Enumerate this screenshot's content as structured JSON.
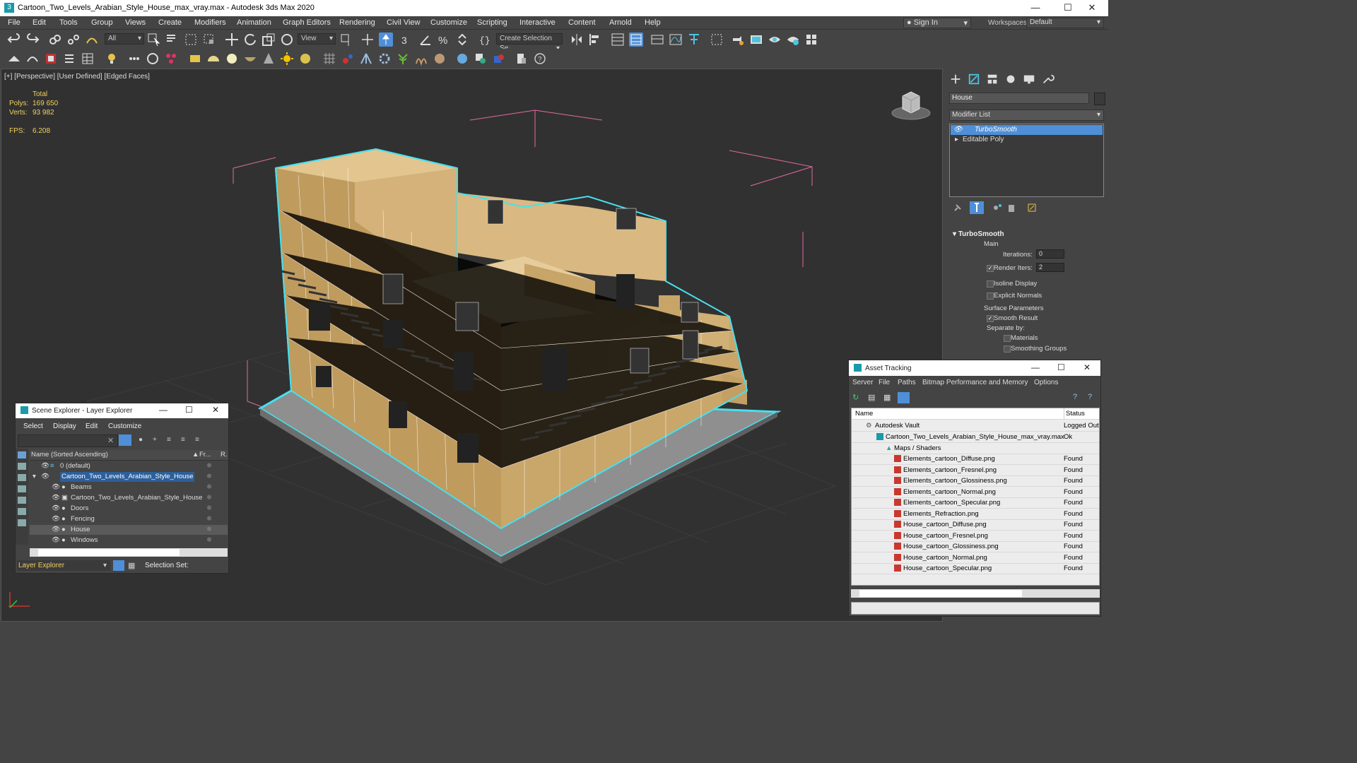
{
  "window": {
    "title": "Cartoon_Two_Levels_Arabian_Style_House_max_vray.max - Autodesk 3ds Max 2020",
    "app_icon": "3",
    "controls": {
      "minimize": "—",
      "maximize": "☐",
      "close": "✕"
    }
  },
  "menu": [
    "File",
    "Edit",
    "Tools",
    "Group",
    "Views",
    "Create",
    "Modifiers",
    "Animation",
    "Graph Editors",
    "Rendering",
    "Civil View",
    "Customize",
    "Scripting",
    "Interactive",
    "Content",
    "Arnold",
    "Help"
  ],
  "account": {
    "signin": "Sign In",
    "workspaces_label": "Workspaces:",
    "workspace": "Default"
  },
  "toolbar": {
    "filter_combo": "All",
    "refcoord_combo": "View",
    "selset_combo": "Create Selection Se"
  },
  "viewport": {
    "label": "[+] [Perspective] [User Defined] [Edged Faces]",
    "stats": {
      "total_label": "Total",
      "polys_label": "Polys:",
      "polys": "169 650",
      "verts_label": "Verts:",
      "verts": "93 982",
      "fps_label": "FPS:",
      "fps": "6.208"
    }
  },
  "command_panel": {
    "object_name": "House",
    "modifier_list": "Modifier List",
    "stack": [
      "TurboSmooth",
      "Editable Poly"
    ],
    "rollout": {
      "title": "TurboSmooth",
      "main_label": "Main",
      "iterations_label": "Iterations:",
      "iterations": "0",
      "render_iters_label": "Render Iters:",
      "render_iters": "2",
      "isoline": "Isoline Display",
      "explicit_normals": "Explicit Normals",
      "surface_params": "Surface Parameters",
      "smooth_result": "Smooth Result",
      "separate_by": "Separate by:",
      "materials": "Materials",
      "smoothing_groups": "Smoothing Groups"
    }
  },
  "scene_explorer": {
    "title": "Scene Explorer - Layer Explorer",
    "menus": [
      "Select",
      "Display",
      "Edit",
      "Customize"
    ],
    "col_name": "Name (Sorted Ascending)",
    "col_fr": "Fr...",
    "col_r": "R.",
    "rows": [
      {
        "name": "0 (default)",
        "level": 0
      },
      {
        "name": "Cartoon_Two_Levels_Arabian_Style_House",
        "level": 0
      },
      {
        "name": "Beams",
        "level": 1
      },
      {
        "name": "Cartoon_Two_Levels_Arabian_Style_House",
        "level": 1
      },
      {
        "name": "Doors",
        "level": 1
      },
      {
        "name": "Fencing",
        "level": 1
      },
      {
        "name": "House",
        "level": 1
      },
      {
        "name": "Windows",
        "level": 1
      }
    ],
    "footer_combo": "Layer Explorer",
    "selection_set": "Selection Set:"
  },
  "asset_tracking": {
    "title": "Asset Tracking",
    "menus": [
      "Server",
      "File",
      "Paths",
      "Bitmap Performance and Memory",
      "Options"
    ],
    "col_name": "Name",
    "col_status": "Status",
    "rows": [
      {
        "name": "Autodesk Vault",
        "status": "Logged Out",
        "type": "vault"
      },
      {
        "name": "Cartoon_Two_Levels_Arabian_Style_House_max_vray.max",
        "status": "Ok",
        "type": "max"
      },
      {
        "name": "Maps / Shaders",
        "status": "",
        "type": "folder"
      },
      {
        "name": "Elements_cartoon_Diffuse.png",
        "status": "Found",
        "type": "png"
      },
      {
        "name": "Elements_cartoon_Fresnel.png",
        "status": "Found",
        "type": "png"
      },
      {
        "name": "Elements_cartoon_Glossiness.png",
        "status": "Found",
        "type": "png"
      },
      {
        "name": "Elements_cartoon_Normal.png",
        "status": "Found",
        "type": "png"
      },
      {
        "name": "Elements_cartoon_Specular.png",
        "status": "Found",
        "type": "png"
      },
      {
        "name": "Elements_Refraction.png",
        "status": "Found",
        "type": "png"
      },
      {
        "name": "House_cartoon_Diffuse.png",
        "status": "Found",
        "type": "png"
      },
      {
        "name": "House_cartoon_Fresnel.png",
        "status": "Found",
        "type": "png"
      },
      {
        "name": "House_cartoon_Glossiness.png",
        "status": "Found",
        "type": "png"
      },
      {
        "name": "House_cartoon_Normal.png",
        "status": "Found",
        "type": "png"
      },
      {
        "name": "House_cartoon_Specular.png",
        "status": "Found",
        "type": "png"
      }
    ]
  },
  "colors": {
    "accent": "#4f8fd8",
    "stats_text": "#f2d060",
    "selection_cyan": "#46e0f0",
    "bbox_pink": "#e06ca0"
  }
}
